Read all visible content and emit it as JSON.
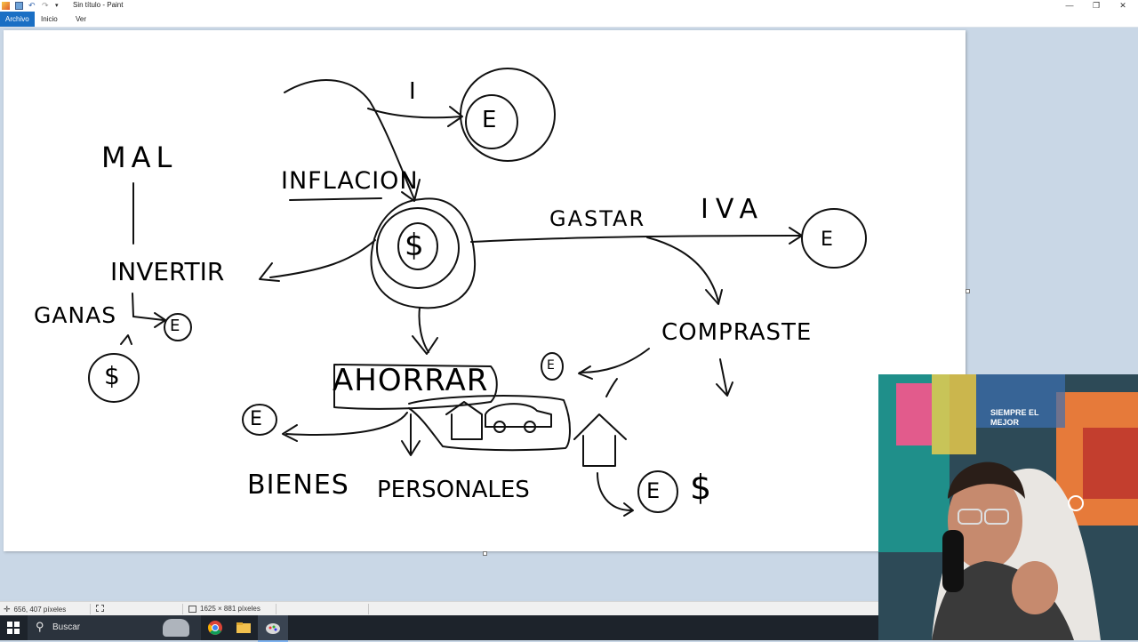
{
  "window": {
    "title": "Sin título - Paint",
    "controls": {
      "minimize": "—",
      "restore": "❐",
      "close": "✕"
    }
  },
  "menu": {
    "items": [
      "Archivo",
      "Inicio",
      "Ver"
    ],
    "active": "Archivo",
    "accent": "#1a6fc4"
  },
  "drawing": {
    "labels": {
      "tax_i": "I",
      "e": "E",
      "mal": "MAL",
      "inflacion": "INFLACION",
      "gastar": "GASTAR",
      "iva": "IVA",
      "invertir": "INVERTIR",
      "ganas": "GANAS",
      "dollar": "$",
      "compraste": "COMPRASTE",
      "ahorrar": "AHORRAR",
      "bienes": "BIENES",
      "personales": "PERSONALES"
    }
  },
  "status": {
    "cursor_position": "656, 407 píxeles",
    "canvas_size": "1625 × 881 píxeles"
  },
  "taskbar": {
    "search_placeholder": "Buscar",
    "icons": [
      "windows-start-icon",
      "search-icon",
      "chrome-icon",
      "file-explorer-icon",
      "paint-icon"
    ]
  },
  "webcam": {
    "wall_text": "SIEMPRE EL MEJOR"
  }
}
